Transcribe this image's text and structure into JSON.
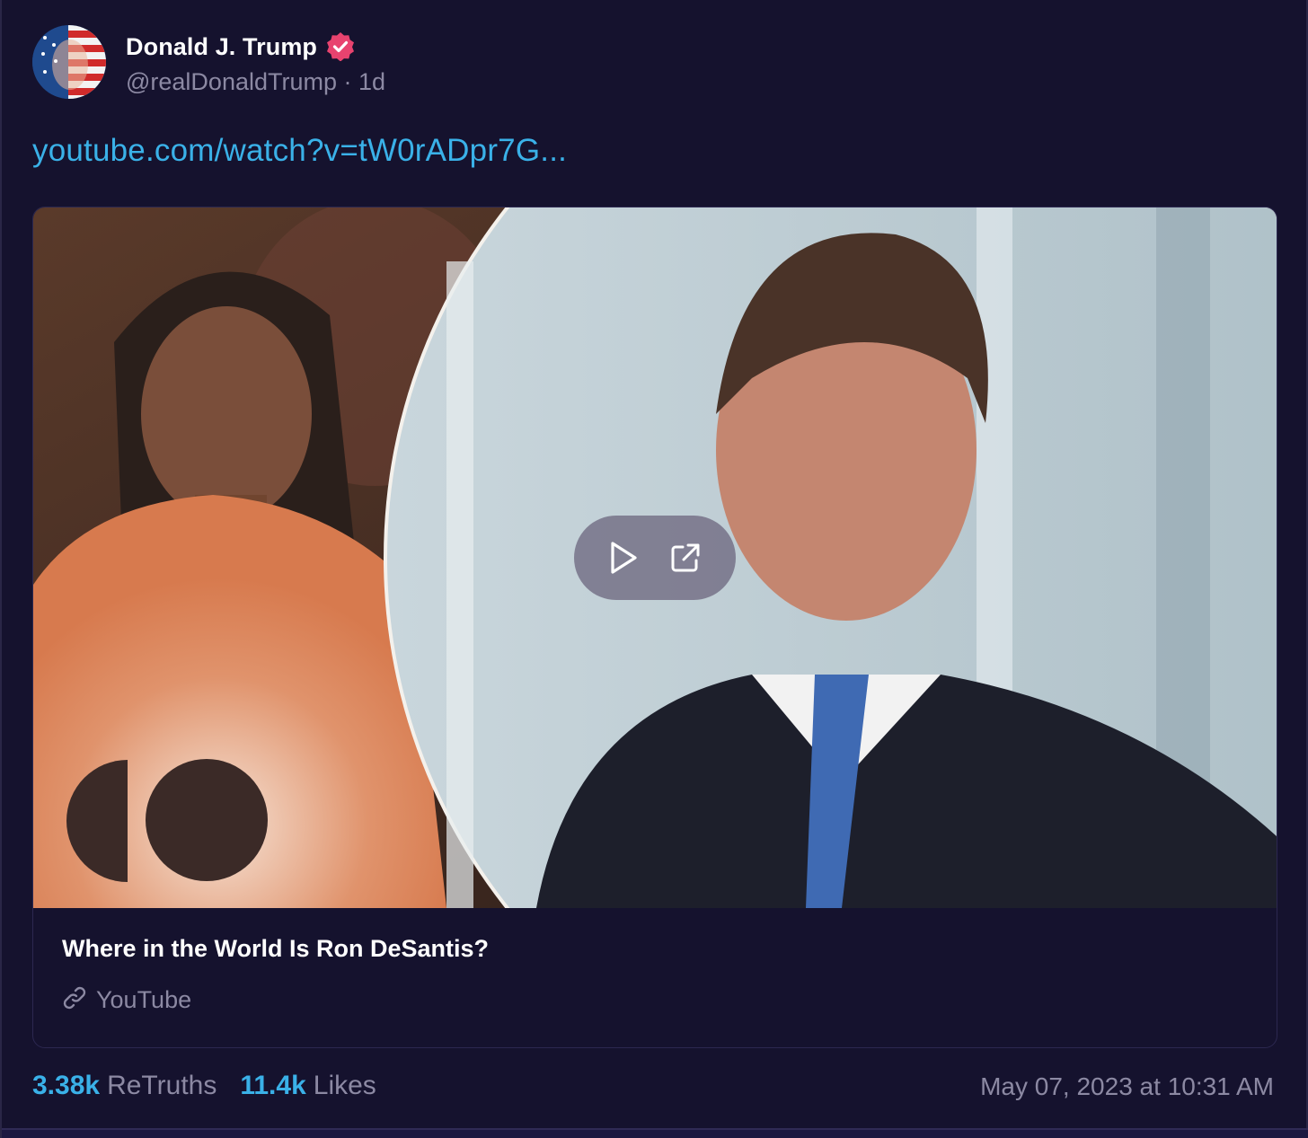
{
  "post": {
    "author_name": "Donald J. Trump",
    "handle": "@realDonaldTrump",
    "separator": "·",
    "age": "1d",
    "link_text": "youtube.com/watch?v=tW0rADpr7G...",
    "verified_icon": "verified-badge-icon",
    "accent_color": "#3ab1e8"
  },
  "card": {
    "title": "Where in the World Is Ron DeSantis?",
    "source": "YouTube",
    "source_icon": "link-icon",
    "play_icon": "play-icon",
    "external_icon": "external-link-icon"
  },
  "stats": {
    "retruths_count": "3.38k",
    "retruths_label": "ReTruths",
    "likes_count": "11.4k",
    "likes_label": "Likes",
    "timestamp": "May 07, 2023 at 10:31 AM"
  }
}
